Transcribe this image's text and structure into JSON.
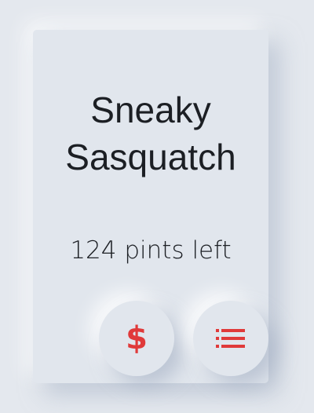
{
  "card": {
    "title_line1": "Sneaky",
    "title_line2": "Sasquatch",
    "pints_text": "124 pints left"
  },
  "buttons": {
    "price_icon": "dollar-icon",
    "list_icon": "list-icon"
  },
  "colors": {
    "accent": "#e03a3a",
    "background": "#e4e8ee",
    "text": "#1c1f24"
  }
}
